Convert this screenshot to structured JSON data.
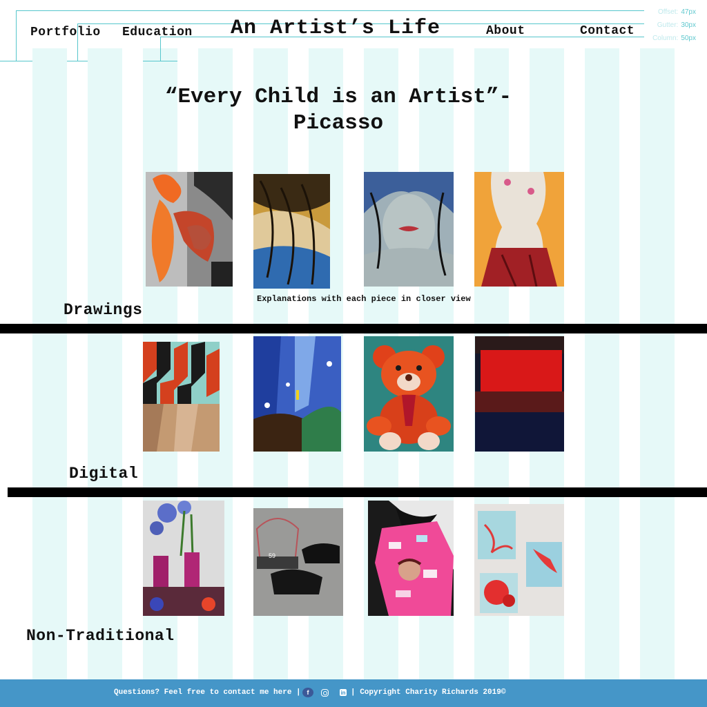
{
  "grid_info": {
    "offset_label": "Offset:",
    "offset_value": "47px",
    "gutter_label": "Gutter:",
    "gutter_value": "30px",
    "column_label": "Column:",
    "column_value": "50px"
  },
  "nav": {
    "portfolio": "Portfolio",
    "education": "Education",
    "about": "About",
    "contact": "Contact"
  },
  "site_title": "An Artist’s Life",
  "quote": "“Every Child is an Artist”- Picasso",
  "sections": {
    "drawings": "Drawings",
    "digital": "Digital",
    "non_traditional": "Non-Traditional"
  },
  "caption": "Explanations with each piece in closer view",
  "footer": {
    "questions": "Questions? Feel free to contact me here |",
    "copyright": "| Copyright Charity Richards 2019©"
  },
  "icons": {
    "facebook": "facebook-icon",
    "instagram": "instagram-icon",
    "linkedin": "linkedin-icon"
  },
  "colors": {
    "grid_column": "#e6f9f8",
    "guide_line": "#55c6cc",
    "footer_bg": "#4596c8",
    "divider": "#000000"
  }
}
